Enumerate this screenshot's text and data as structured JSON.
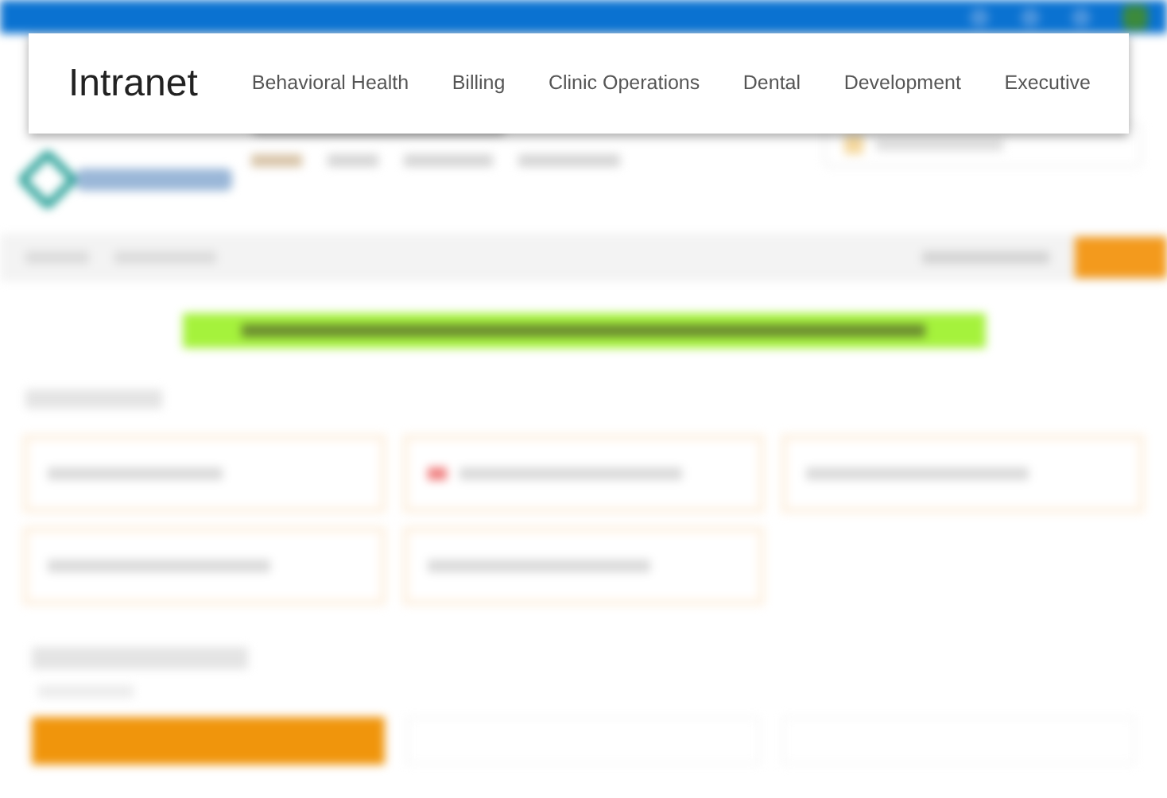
{
  "mega_menu": {
    "title": "Intranet",
    "items": [
      {
        "label": "Behavioral Health"
      },
      {
        "label": "Billing"
      },
      {
        "label": "Clinic Operations"
      },
      {
        "label": "Dental"
      },
      {
        "label": "Development"
      },
      {
        "label": "Executive"
      }
    ]
  }
}
